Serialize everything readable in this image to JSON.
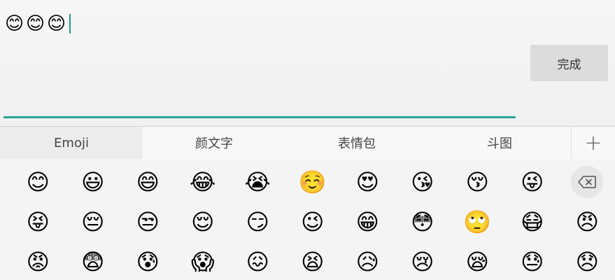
{
  "input": {
    "typed_emojis": [
      "😊",
      "😊",
      "😊"
    ]
  },
  "done_button": {
    "label": "完成"
  },
  "tabs": [
    {
      "label": "Emoji",
      "active": true
    },
    {
      "label": "颜文字",
      "active": false
    },
    {
      "label": "表情包",
      "active": false
    },
    {
      "label": "斗图",
      "active": false
    },
    {
      "label": "+",
      "active": false
    }
  ],
  "emoji_rows": [
    [
      "😊",
      "😃",
      "😄",
      "😂",
      "😭",
      "☺️",
      "😍",
      "😘",
      "😚",
      "😜"
    ],
    [
      "😝",
      "😔",
      "😒",
      "😌",
      "😏",
      "😉",
      "😁",
      "😳",
      "🙄",
      "😷",
      "😠"
    ],
    [
      "😡",
      "😨",
      "😰",
      "😱",
      "😖",
      "😫",
      "😥",
      "😢",
      "😪",
      "😓",
      "😞"
    ]
  ],
  "backspace_icon": "backspace-icon",
  "colors": {
    "accent": "#2aa593",
    "done_button_bg": "#dcdcdc"
  }
}
